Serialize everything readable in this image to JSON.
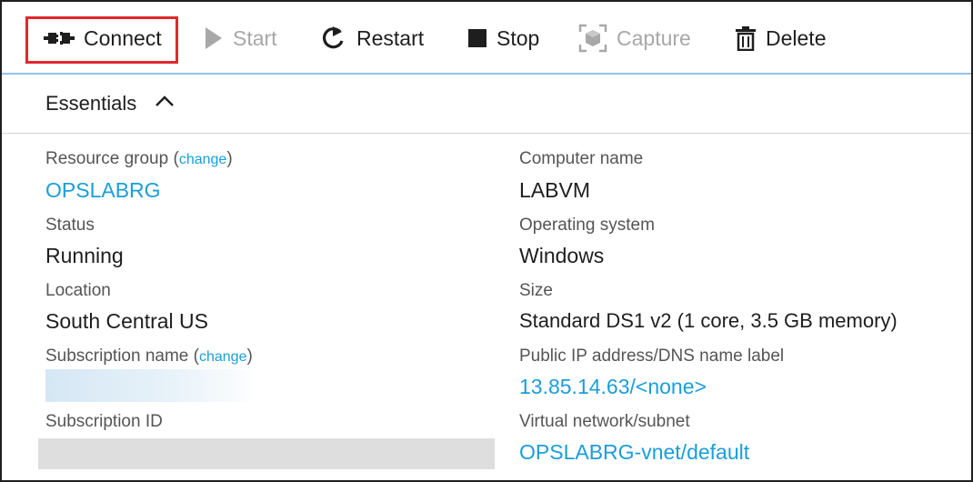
{
  "toolbar": {
    "connect": "Connect",
    "start": "Start",
    "restart": "Restart",
    "stop": "Stop",
    "capture": "Capture",
    "delete": "Delete"
  },
  "essentials": {
    "title": "Essentials"
  },
  "left": {
    "resource_group_label": "Resource group",
    "change_text": "change",
    "resource_group_value": "OPSLABRG",
    "status_label": "Status",
    "status_value": "Running",
    "location_label": "Location",
    "location_value": "South Central US",
    "subscription_name_label": "Subscription name",
    "subscription_id_label": "Subscription ID"
  },
  "right": {
    "computer_name_label": "Computer name",
    "computer_name_value": "LABVM",
    "os_label": "Operating system",
    "os_value": "Windows",
    "size_label": "Size",
    "size_value": "Standard DS1 v2 (1 core, 3.5 GB memory)",
    "public_ip_label": "Public IP address/DNS name label",
    "public_ip_value": "13.85.14.63/<none>",
    "vnet_label": "Virtual network/subnet",
    "vnet_value": "OPSLABRG-vnet/default"
  },
  "colors": {
    "link": "#1a9ed9",
    "highlight": "#e0282e",
    "toolbar_border": "#8fc3ea"
  }
}
